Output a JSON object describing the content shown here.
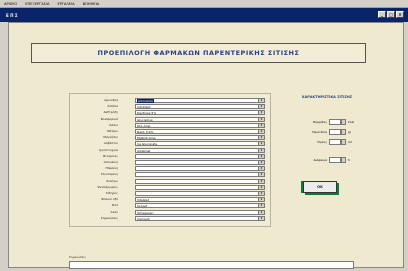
{
  "menubar": {
    "items": [
      "ΑΡΧΕΙΟ",
      "ΕΠΕΞΕΡΓΑΣΙΑ",
      "ΕΡΓΑΛΕΙΑ",
      "ΒΟΗΘΕΙΑ"
    ]
  },
  "window": {
    "title": "Ε Π Σ",
    "btn_min": "_",
    "btn_max": "□",
    "btn_close": "×"
  },
  "form": {
    "banner_title": "ΠΡΟΕΠΙΛΟΓΗ ΦΑΡΜΑΚΩΝ ΠΑΡΕΝΤΕΡΙΚΗΣ ΣΙΤΙΣΗΣ",
    "fields": [
      {
        "label": "Αμινοξέα",
        "value": "Aminomix",
        "selected": true
      },
      {
        "label": "Λιπίδια",
        "value": "Intralipid",
        "selected": false
      },
      {
        "label": "Δεξτρόζη",
        "value": "Dextrose 5%",
        "selected": false
      },
      {
        "label": "Φωσφορικά",
        "value": "Glycophos",
        "selected": false
      },
      {
        "label": "Κάλιο",
        "value": "KCL Amp",
        "selected": false
      },
      {
        "label": "Νάτριο",
        "value": "NaCL 0.9%",
        "selected": false
      },
      {
        "label": "Μαγνήσιο",
        "value": "MgSO4 Amp",
        "selected": false
      },
      {
        "label": "Ασβέστιο",
        "value": "Ca Gluconate",
        "selected": false
      },
      {
        "label": "Ιχνοστοιχεία",
        "value": "Addamel",
        "selected": false
      },
      {
        "label": "Βιταμίνες",
        "value": "",
        "selected": false
      },
      {
        "label": "Ινσουλίνη",
        "value": "",
        "selected": false
      },
      {
        "label": "Ηπαρίνη",
        "value": "",
        "selected": false
      },
      {
        "label": "Γλουταμίνη",
        "value": "",
        "selected": false
      },
      {
        "label": "Σελήνιο",
        "value": "",
        "selected": false
      },
      {
        "label": "Ψευδάργυρος",
        "value": "",
        "selected": false
      },
      {
        "label": "Σίδηρος",
        "value": "",
        "selected": false
      },
      {
        "label": "Φολικό οξύ",
        "value": "Vitalipid",
        "selected": false
      },
      {
        "label": "Β12",
        "value": "Soluvit",
        "selected": false
      },
      {
        "label": "Άλλο",
        "value": "Omegaven",
        "selected": false
      },
      {
        "label": "Σημειώσεις",
        "value": "Cernevit",
        "selected": false
      }
    ],
    "side_title": "ΧΑΡΑΚΤΗΡΙΣΤΙΚΑ ΣΙΤΙΣΗΣ",
    "spinners": [
      {
        "label": "Θερμίδες",
        "unit": "kcal"
      },
      {
        "label": "Πρωτεΐνη",
        "unit": "gr"
      },
      {
        "label": "Όγκος",
        "unit": "ml"
      },
      {
        "label": "Διάρκεια",
        "unit": "h"
      }
    ],
    "ok_label": "ΟΚ",
    "notes_label": "Σημειώσεις"
  },
  "colors": {
    "accent": "#27408b",
    "titlebar": "#0a246a",
    "ok_accent": "#0d7a3a",
    "form_bg": "#efe9cf"
  }
}
